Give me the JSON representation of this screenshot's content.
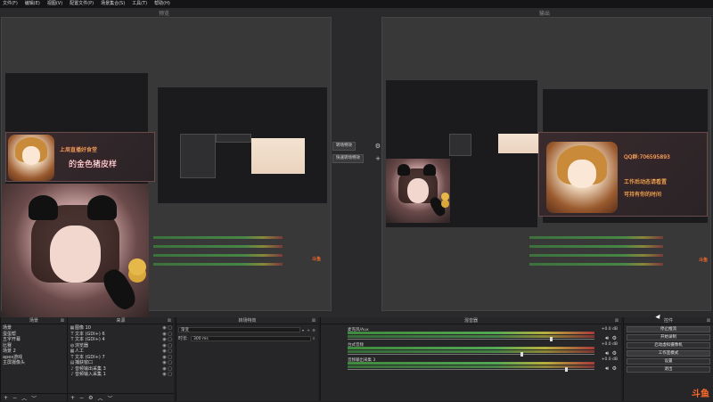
{
  "menu": [
    "文件(F)",
    "编辑(E)",
    "视图(V)",
    "配置文件(P)",
    "场景集合(S)",
    "工具(T)",
    "帮助(H)"
  ],
  "preview_label": "预览",
  "program_label": "输出",
  "transition_buttons": {
    "transition": "转场特效",
    "quick": "快速转场特效",
    "gear": "⚙",
    "plus": "+"
  },
  "overlay_left": {
    "line1": "上周直播好食堂",
    "line2": "的金色猪皮样"
  },
  "overlay_right": {
    "line1": "QQ群:706595893",
    "line2": "工作后动态请看置",
    "line3": "可持有你的时间"
  },
  "scenes": {
    "title": "场景",
    "items": [
      "场景",
      "蛋蛋帮",
      "五字开幕",
      "比赛",
      "场景 2",
      "apex游戏",
      "主屏摄像头"
    ],
    "footer": [
      "+",
      "−",
      "︿",
      "﹀"
    ]
  },
  "sources": {
    "title": "来源",
    "items": [
      {
        "icon": "▦",
        "label": "图像 10"
      },
      {
        "icon": "T",
        "label": "文本 (GDI+) 6"
      },
      {
        "icon": "T",
        "label": "文本 (GDI+) 4"
      },
      {
        "icon": "◍",
        "label": "浏览器"
      },
      {
        "icon": "▦",
        "label": "人工"
      },
      {
        "icon": "T",
        "label": "文本 (GDI+) 7"
      },
      {
        "icon": "▤",
        "label": "捕获窗口"
      },
      {
        "icon": "♪",
        "label": "音频输出采集 3"
      },
      {
        "icon": "♪",
        "label": "音频输入采集 1"
      }
    ],
    "footer": [
      "+",
      "−",
      "⚙",
      "︿",
      "﹀"
    ]
  },
  "transitions": {
    "title": "转场特效",
    "type_value": "渐变",
    "duration_label": "时长",
    "duration_value": "300 ms"
  },
  "mixer": {
    "title": "混音器",
    "channels": [
      {
        "name": "麦克风/Aux",
        "db": "+0.0 dB",
        "level": 0.82
      },
      {
        "name": "台式音频",
        "db": "+0.0 dB",
        "level": 0.7
      },
      {
        "name": "音频输出采集 3",
        "db": "+0.0 dB",
        "level": 0.88
      }
    ]
  },
  "controls": {
    "title": "控件",
    "buttons": [
      "停止推流",
      "开始录制",
      "启动虚拟摄像机",
      "工作室模式",
      "设置",
      "退出"
    ]
  },
  "watermark": "斗鱼"
}
